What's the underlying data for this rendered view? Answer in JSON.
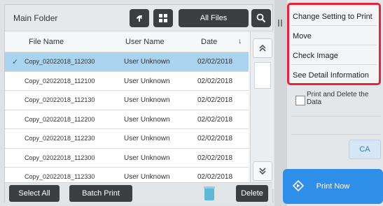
{
  "header": {
    "folder_title": "Main Folder",
    "filter_label": "All Files"
  },
  "columns": {
    "file_name": "File Name",
    "user_name": "User Name",
    "date": "Date"
  },
  "rows": [
    {
      "file_name": "Copy_02022018_112030",
      "user_name": "User Unknown",
      "date": "02/02/2018",
      "selected": true
    },
    {
      "file_name": "Copy_02022018_112100",
      "user_name": "User Unknown",
      "date": "02/02/2018",
      "selected": false
    },
    {
      "file_name": "Copy_02022018_112130",
      "user_name": "User Unknown",
      "date": "02/02/2018",
      "selected": false
    },
    {
      "file_name": "Copy_02022018_112200",
      "user_name": "User Unknown",
      "date": "02/02/2018",
      "selected": false
    },
    {
      "file_name": "Copy_02022018_112230",
      "user_name": "User Unknown",
      "date": "02/02/2018",
      "selected": false
    },
    {
      "file_name": "Copy_02022018_112300",
      "user_name": "User Unknown",
      "date": "02/02/2018",
      "selected": false
    },
    {
      "file_name": "Copy_02022018_112330",
      "user_name": "User Unknown",
      "date": "02/02/2018",
      "selected": false
    }
  ],
  "bottom": {
    "select_all": "Select All",
    "batch_print": "Batch Print",
    "delete": "Delete"
  },
  "menu": {
    "items": [
      "Change Setting to Print",
      "Move",
      "Check Image",
      "See Detail Information"
    ]
  },
  "options": {
    "print_and_delete": "Print and Delete the Data",
    "ca": "CA",
    "print_now": "Print Now"
  },
  "icons": {
    "back": "back-arrow-icon",
    "grid": "grid-view-icon",
    "search": "search-icon",
    "sort": "sort-down-icon",
    "scroll_up": "scroll-up-icon",
    "scroll_down": "scroll-down-icon",
    "trash": "trash-icon",
    "print": "print-now-icon",
    "check": "check-icon"
  },
  "colors": {
    "selected_row": "#a9d3ee",
    "highlight_border": "#e8223a",
    "dark_button": "#3c3f42",
    "print_now": "#2f8ee8",
    "ca_text": "#2a7ac9"
  }
}
